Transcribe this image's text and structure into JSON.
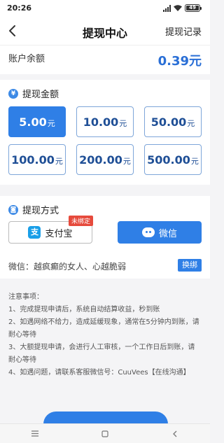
{
  "status_bar": {
    "time": "20:26",
    "battery": "49"
  },
  "nav": {
    "title": "提现中心",
    "right_link": "提现记录"
  },
  "balance": {
    "label": "账户余额",
    "value": "0.39元"
  },
  "amount_section": {
    "icon": "yen-icon",
    "title": "提现金额",
    "selected_index": 0,
    "options": [
      {
        "amount": "5.00",
        "unit": "元"
      },
      {
        "amount": "10.00",
        "unit": "元"
      },
      {
        "amount": "50.00",
        "unit": "元"
      },
      {
        "amount": "100.00",
        "unit": "元"
      },
      {
        "amount": "200.00",
        "unit": "元"
      },
      {
        "amount": "500.00",
        "unit": "元"
      }
    ]
  },
  "method_section": {
    "icon": "wallet-icon",
    "title": "提现方式",
    "alipay": {
      "icon_text": "支",
      "label": "支付宝",
      "tag": "未绑定"
    },
    "wechat": {
      "label": "微信",
      "selected": true
    },
    "account_text": "微信：越疯癫的女人、心越脆弱",
    "switch_label": "换绑"
  },
  "notes": {
    "title": "注意事项：",
    "items": [
      "1、完成提现申请后，系统自动结算收益，秒到账",
      "2、如遇网络不给力，造成延缓现象，通常在5分钟内到账，请耐心等待",
      "3、大额提现申请，会进行人工审核，一个工作日后到账，请耐心等待",
      "4、如遇问题，请联系客服微信号：CuuVees【在线沟通】"
    ]
  },
  "colors": {
    "accent": "#2f7fe6",
    "balance": "#2a6fd6",
    "tag": "#e64a3c"
  }
}
